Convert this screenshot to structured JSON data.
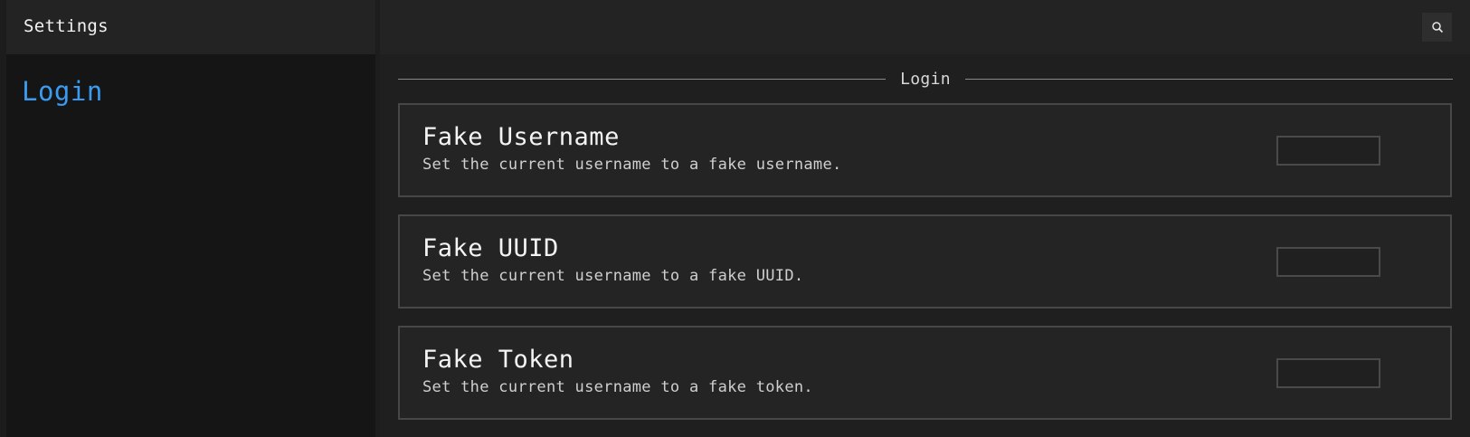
{
  "sidebar": {
    "title": "Settings",
    "items": [
      {
        "label": "Login",
        "active": true
      }
    ]
  },
  "topbar": {
    "search_icon": "search-icon"
  },
  "section": {
    "label": "Login"
  },
  "settings": [
    {
      "title": "Fake Username",
      "description": "Set the current username to a fake username.",
      "value": ""
    },
    {
      "title": "Fake UUID",
      "description": "Set the current username to a fake UUID.",
      "value": ""
    },
    {
      "title": "Fake Token",
      "description": "Set the current username to a fake token.",
      "value": ""
    }
  ],
  "colors": {
    "accent": "#3a9bf0",
    "background": "#151515",
    "panel": "#242424",
    "border": "#474747"
  }
}
